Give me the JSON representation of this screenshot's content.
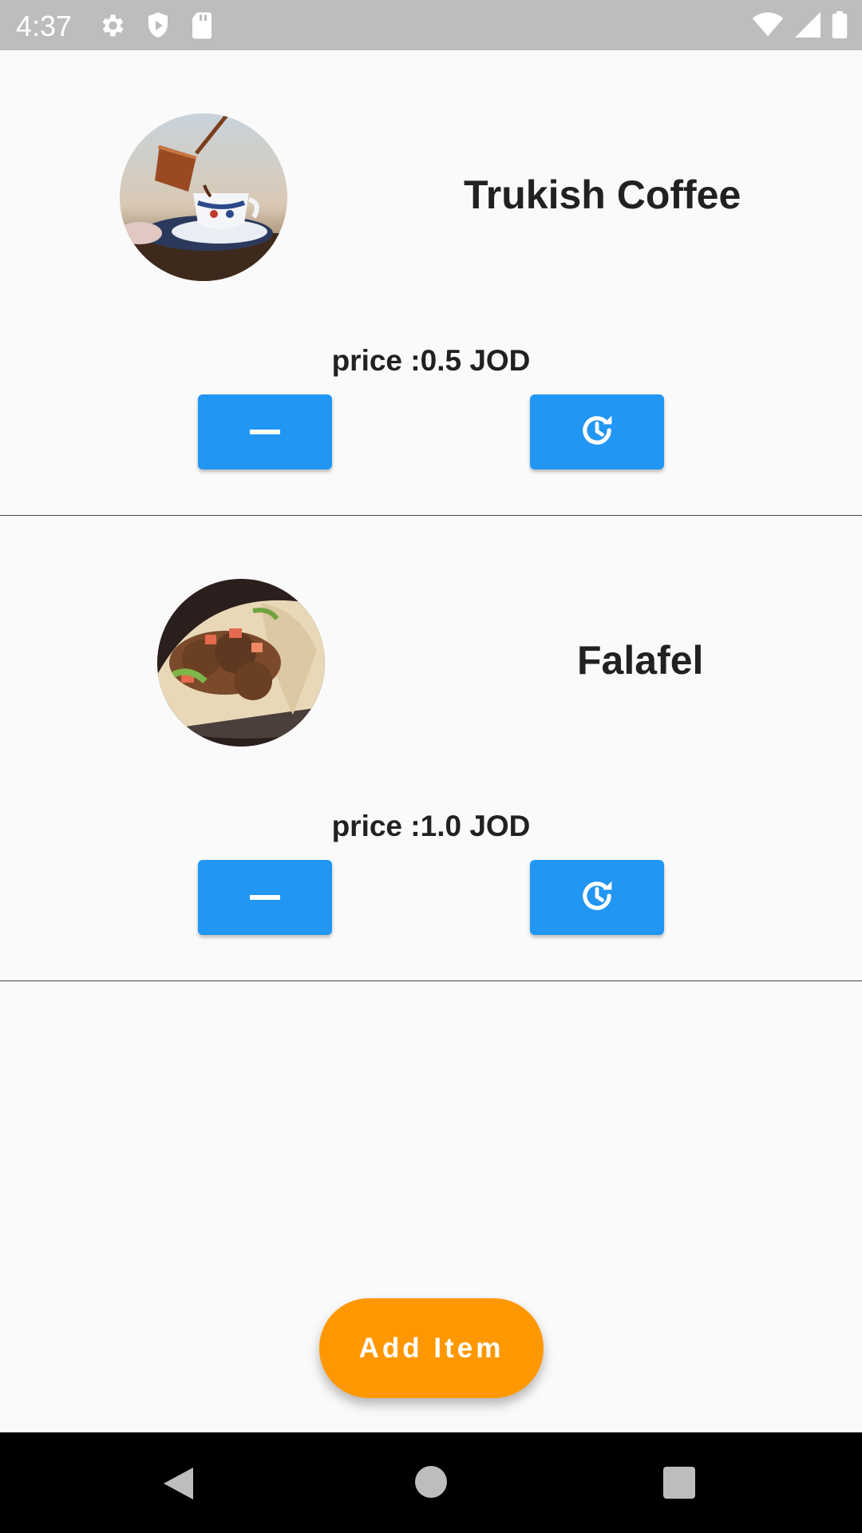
{
  "status_bar": {
    "time": "4:37",
    "left_icons": [
      "settings-icon",
      "shield-icon",
      "sd-card-icon"
    ],
    "right_icons": [
      "wifi-icon",
      "signal-icon",
      "battery-icon"
    ]
  },
  "items": [
    {
      "name": "Trukish Coffee",
      "price_label": "price :0.5 JOD",
      "image": "turkish-coffee-photo",
      "remove_icon": "minus-icon",
      "history_icon": "history-icon"
    },
    {
      "name": "Falafel",
      "price_label": "price :1.0 JOD",
      "image": "falafel-photo",
      "remove_icon": "minus-icon",
      "history_icon": "history-icon"
    }
  ],
  "fab": {
    "label": "Add Item"
  },
  "colors": {
    "primary": "#2196f3",
    "accent": "#ff9800",
    "background": "#fafafa",
    "status_bar": "#bdbdbd",
    "nav_bar": "#000000"
  },
  "nav_bar": {
    "icons": [
      "back-icon",
      "home-icon",
      "recents-icon"
    ]
  }
}
